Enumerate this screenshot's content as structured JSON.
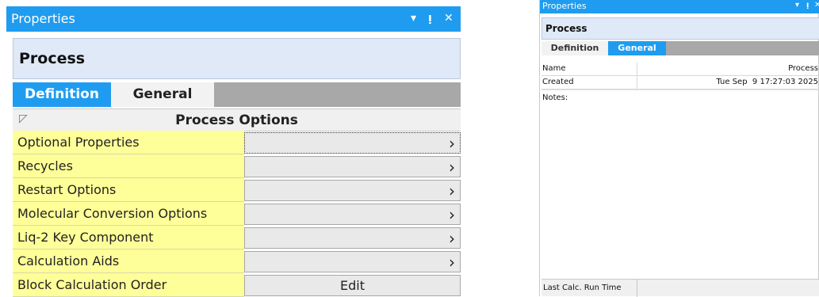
{
  "left_panel": {
    "title": "Properties",
    "controls": {
      "dropdown": "▾",
      "pin": "ᵖ",
      "close": "✕"
    },
    "header": "Process",
    "tabs": {
      "active": "Definition",
      "inactive": "General"
    },
    "section": {
      "collapse_glyph": "◸",
      "title": "Process Options"
    },
    "rows": [
      {
        "label": "Optional Properties",
        "value": "›"
      },
      {
        "label": "Recycles",
        "value": "›"
      },
      {
        "label": "Restart Options",
        "value": "›"
      },
      {
        "label": "Molecular Conversion Options",
        "value": "›"
      },
      {
        "label": "Liq-2 Key Component",
        "value": "›"
      },
      {
        "label": "Calculation Aids",
        "value": "›"
      },
      {
        "label": "Block Calculation Order",
        "value": "Edit"
      }
    ]
  },
  "right_panel": {
    "title": "Properties",
    "controls": {
      "dropdown": "▾",
      "pin": "ᵖ",
      "close": "✕"
    },
    "header": "Process",
    "tabs": {
      "inactive": "Definition",
      "active": "General"
    },
    "grid": [
      {
        "key": "Name",
        "value": "Process"
      },
      {
        "key": "Created",
        "value": "Tue Sep  9 17:27:03 2025"
      }
    ],
    "notes_label": "Notes:",
    "footer_label": "Last Calc. Run Time",
    "footer_value": ""
  },
  "colors": {
    "title_bar": "#1f9cf0",
    "label_cells": "#ffff99",
    "tab_strip": "#a8a8a8"
  },
  "icons": [
    "chevron-right-icon",
    "collapse-icon",
    "dropdown-icon",
    "pin-icon",
    "close-icon"
  ]
}
